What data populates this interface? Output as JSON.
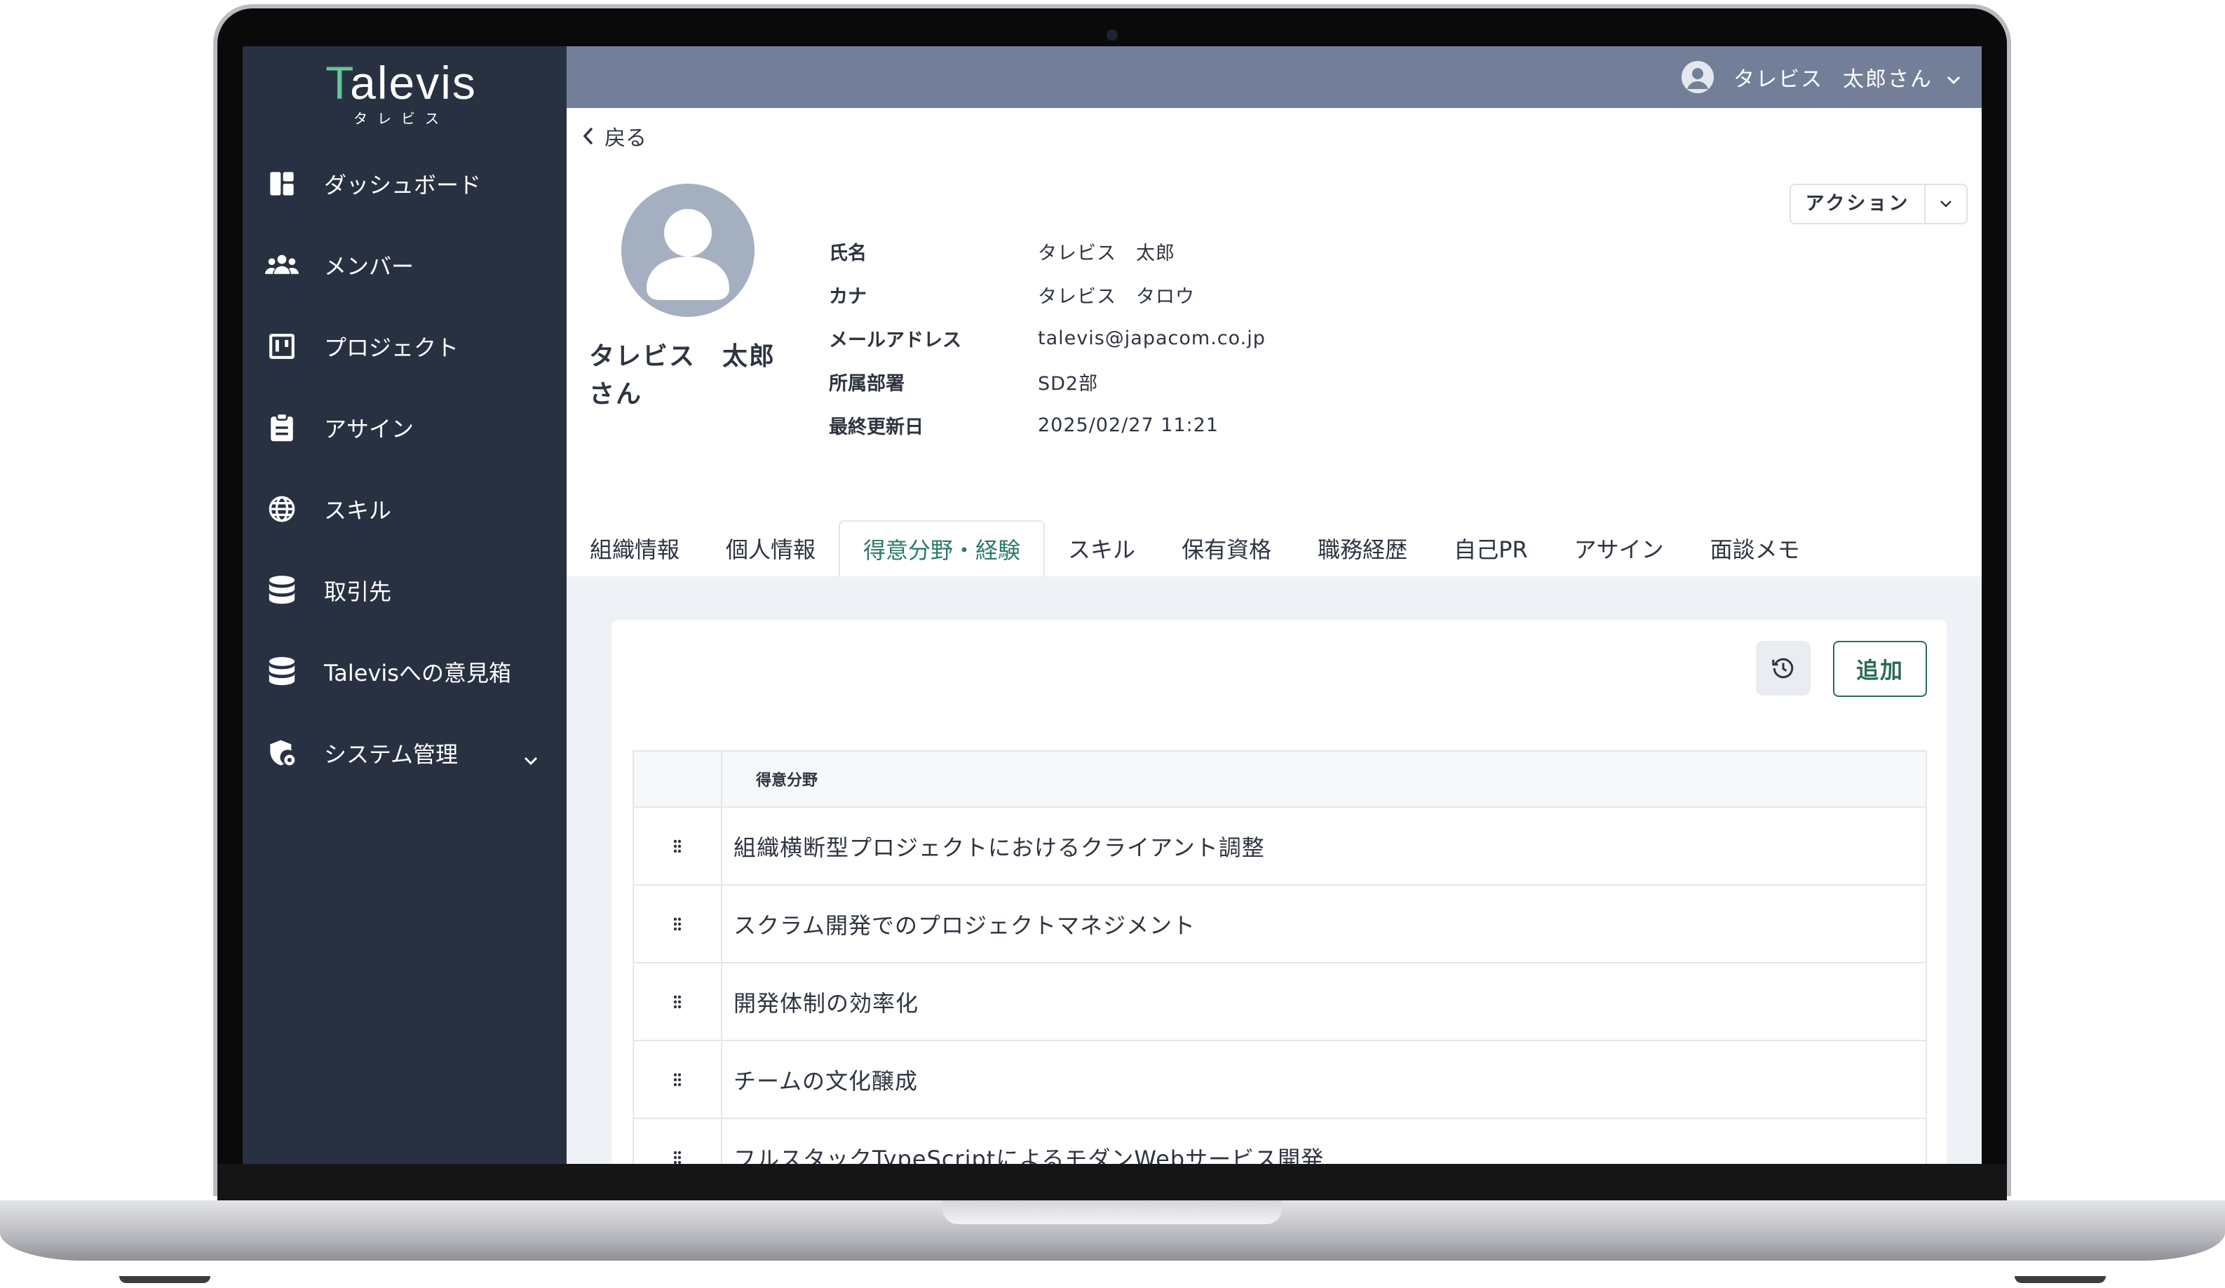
{
  "app": {
    "logo_text": "Talevis",
    "logo_kana": "タレビス"
  },
  "sidebar": {
    "items": [
      {
        "label": "ダッシュボード",
        "icon": "dashboard-icon"
      },
      {
        "label": "メンバー",
        "icon": "members-icon"
      },
      {
        "label": "プロジェクト",
        "icon": "project-board-icon"
      },
      {
        "label": "アサイン",
        "icon": "clipboard-icon"
      },
      {
        "label": "スキル",
        "icon": "globe-icon"
      },
      {
        "label": "取引先",
        "icon": "database-icon"
      },
      {
        "label": "Talevisへの意見箱",
        "icon": "database-icon"
      },
      {
        "label": "システム管理",
        "icon": "shield-gear-icon"
      }
    ]
  },
  "header": {
    "user_company": "タレビス",
    "user_name": "太郎さん"
  },
  "profile": {
    "back_label": "戻る",
    "display_name_line1": "タレビス　太郎",
    "display_name_line2": "さん",
    "fields": [
      {
        "label": "氏名",
        "value": "タレビス　太郎"
      },
      {
        "label": "カナ",
        "value": "タレビス　タロウ"
      },
      {
        "label": "メールアドレス",
        "value": "talevis@japacom.co.jp"
      },
      {
        "label": "所属部署",
        "value": "SD2部"
      },
      {
        "label": "最終更新日",
        "value": "2025/02/27 11:21"
      }
    ],
    "action_label": "アクション"
  },
  "tabs": [
    {
      "label": "組織情報",
      "active": false
    },
    {
      "label": "個人情報",
      "active": false
    },
    {
      "label": "得意分野・経験",
      "active": true
    },
    {
      "label": "スキル",
      "active": false
    },
    {
      "label": "保有資格",
      "active": false
    },
    {
      "label": "職務経歴",
      "active": false
    },
    {
      "label": "自己PR",
      "active": false
    },
    {
      "label": "アサイン",
      "active": false
    },
    {
      "label": "面談メモ",
      "active": false
    }
  ],
  "panel": {
    "add_label": "追加",
    "column_header": "得意分野",
    "rows": [
      "組織横断型プロジェクトにおけるクライアント調整",
      "スクラム開発でのプロジェクトマネジメント",
      "開発体制の効率化",
      "チームの文化醸成",
      "フルスタックTypeScriptによるモダンWebサービス開発"
    ]
  },
  "colors": {
    "sidebar_bg": "#283142",
    "header_bg": "#737f98",
    "accent": "#2b7a6a",
    "logo_accent": "#67c596"
  }
}
